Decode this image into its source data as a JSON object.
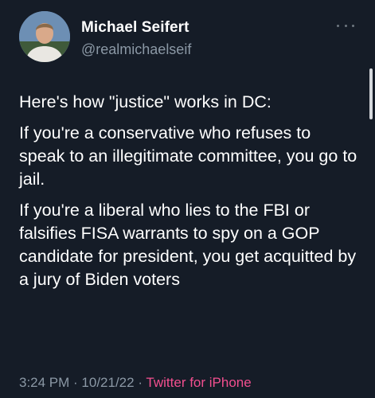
{
  "author": {
    "name": "Michael Seifert",
    "handle": "@realmichaelseif",
    "avatar_icon": "profile-photo"
  },
  "menu": {
    "icon": "more-options-icon"
  },
  "tweet": {
    "paragraphs": [
      "Here's how \"justice\" works in DC:",
      "If you're a conservative who refuses to speak to an illegitimate committee, you go to jail.",
      "If you're a liberal who lies to the FBI or falsifies FISA warrants to spy on a GOP candidate for president, you get acquitted by a jury of Biden voters"
    ]
  },
  "meta": {
    "time": "3:24 PM",
    "separator1": " · ",
    "date": "10/21/22",
    "separator2": " · ",
    "source": "Twitter for iPhone"
  },
  "colors": {
    "background": "#151c27",
    "secondary_text": "#8b98a5",
    "source_link": "#f24f8f"
  }
}
